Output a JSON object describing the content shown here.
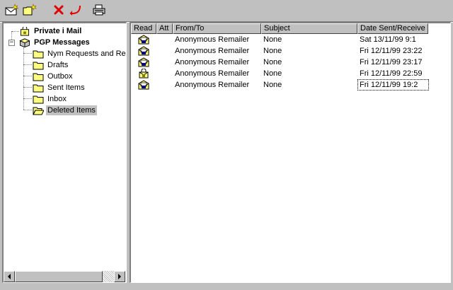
{
  "toolbar": {
    "buttons": [
      {
        "icon": "new-message-icon"
      },
      {
        "icon": "new-folder-icon"
      },
      {
        "icon": "delete-icon"
      },
      {
        "icon": "reply-icon"
      },
      {
        "icon": "print-icon"
      }
    ]
  },
  "tree": {
    "root_label": "Private i Mail",
    "pgp_label": "PGP Messages",
    "folders": [
      {
        "label": "Nym Requests and Re:"
      },
      {
        "label": "Drafts"
      },
      {
        "label": "Outbox"
      },
      {
        "label": "Sent Items"
      },
      {
        "label": "Inbox"
      },
      {
        "label": "Deleted Items"
      }
    ],
    "selected": "Deleted Items"
  },
  "list": {
    "columns": {
      "read": "Read",
      "att": "Att",
      "from": "From/To",
      "subject": "Subject",
      "date": "Date Sent/Receive"
    },
    "rows": [
      {
        "from": "Anonymous Remailer",
        "subject": "None",
        "date": "Sat 13/11/99 9:1",
        "icon": "mail-read-icon"
      },
      {
        "from": "Anonymous Remailer",
        "subject": "None",
        "date": "Fri 12/11/99 23:22",
        "icon": "mail-read-icon"
      },
      {
        "from": "Anonymous Remailer",
        "subject": "None",
        "date": "Fri 12/11/99 23:17",
        "icon": "mail-read-icon"
      },
      {
        "from": "Anonymous Remailer",
        "subject": "None",
        "date": "Fri 12/11/99 22:59",
        "icon": "mail-locked-icon"
      },
      {
        "from": "Anonymous Remailer",
        "subject": "None",
        "date": "Fri 12/11/99 19:2",
        "icon": "mail-read-icon"
      }
    ]
  },
  "colors": {
    "chrome": "#c0c0c0",
    "folder_yellow": "#ffff80",
    "delete_red": "#e00000"
  }
}
